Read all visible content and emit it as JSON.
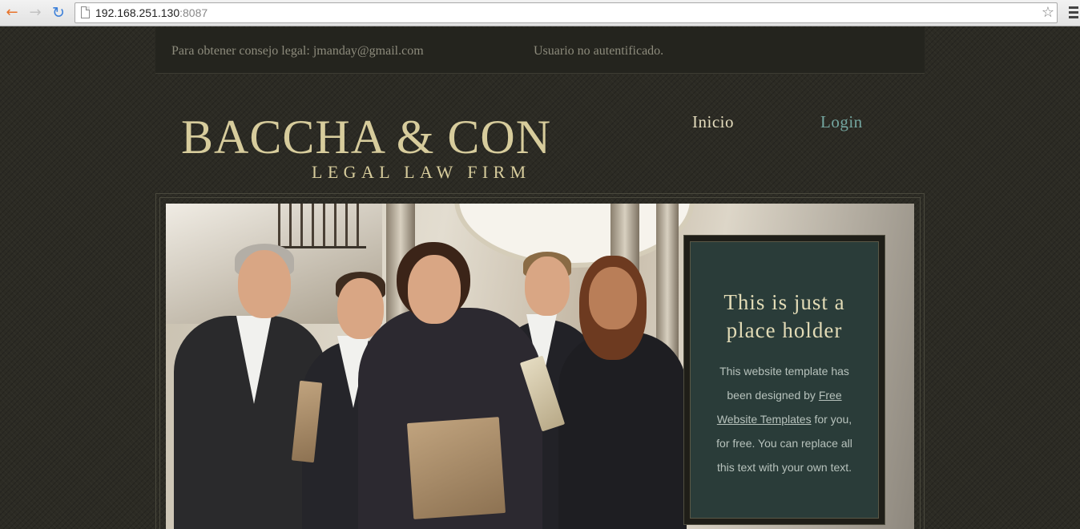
{
  "browser": {
    "url_host": "192.168.251.130",
    "url_port": ":8087"
  },
  "topbar": {
    "contact": "Para obtener consejo legal: jmanday@gmail.com",
    "auth_status": "Usuario no autentificado."
  },
  "logo": {
    "name": "BACCHA & CON",
    "tagline": "LEGAL LAW FIRM"
  },
  "nav": {
    "items": [
      {
        "label": "Inicio"
      },
      {
        "label": "Login"
      }
    ]
  },
  "placeholder": {
    "title": "This is just a place holder",
    "text_before": "This website template has been designed by ",
    "link": "Free Website Templates",
    "text_after": " for you, for free. You can replace all this text with your own text."
  },
  "colors": {
    "background": "#2c2b24",
    "gold": "#d7cc9c",
    "teal_link": "#74a6a0",
    "panel": "#2a3c39"
  }
}
